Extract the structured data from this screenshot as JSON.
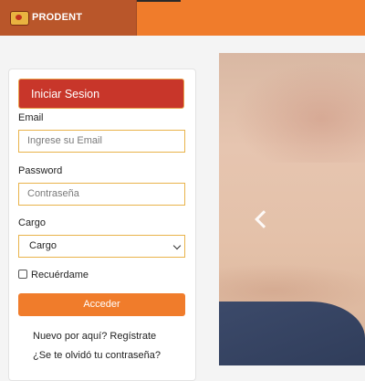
{
  "brand": {
    "name": "PRODENT",
    "icon": "prodent-logo-icon"
  },
  "login": {
    "title": "Iniciar Sesion",
    "email": {
      "label": "Email",
      "placeholder": "Ingrese su Email"
    },
    "password": {
      "label": "Password",
      "placeholder": "Contraseña"
    },
    "role": {
      "label": "Cargo",
      "selected": "Cargo",
      "icon": "chevron-down-icon"
    },
    "remember_label": "Recuérdame",
    "submit_label": "Acceder",
    "register_link": "Nuevo por aquí? Regístrate",
    "forgot_link": "¿Se te olvidó tu contraseña?"
  },
  "carousel": {
    "prev_icon": "chevron-left-icon"
  },
  "colors": {
    "accent": "#f07c2b",
    "brand_dark": "#b9562a",
    "header_red": "#c8362a",
    "input_border": "#e9b34b"
  }
}
